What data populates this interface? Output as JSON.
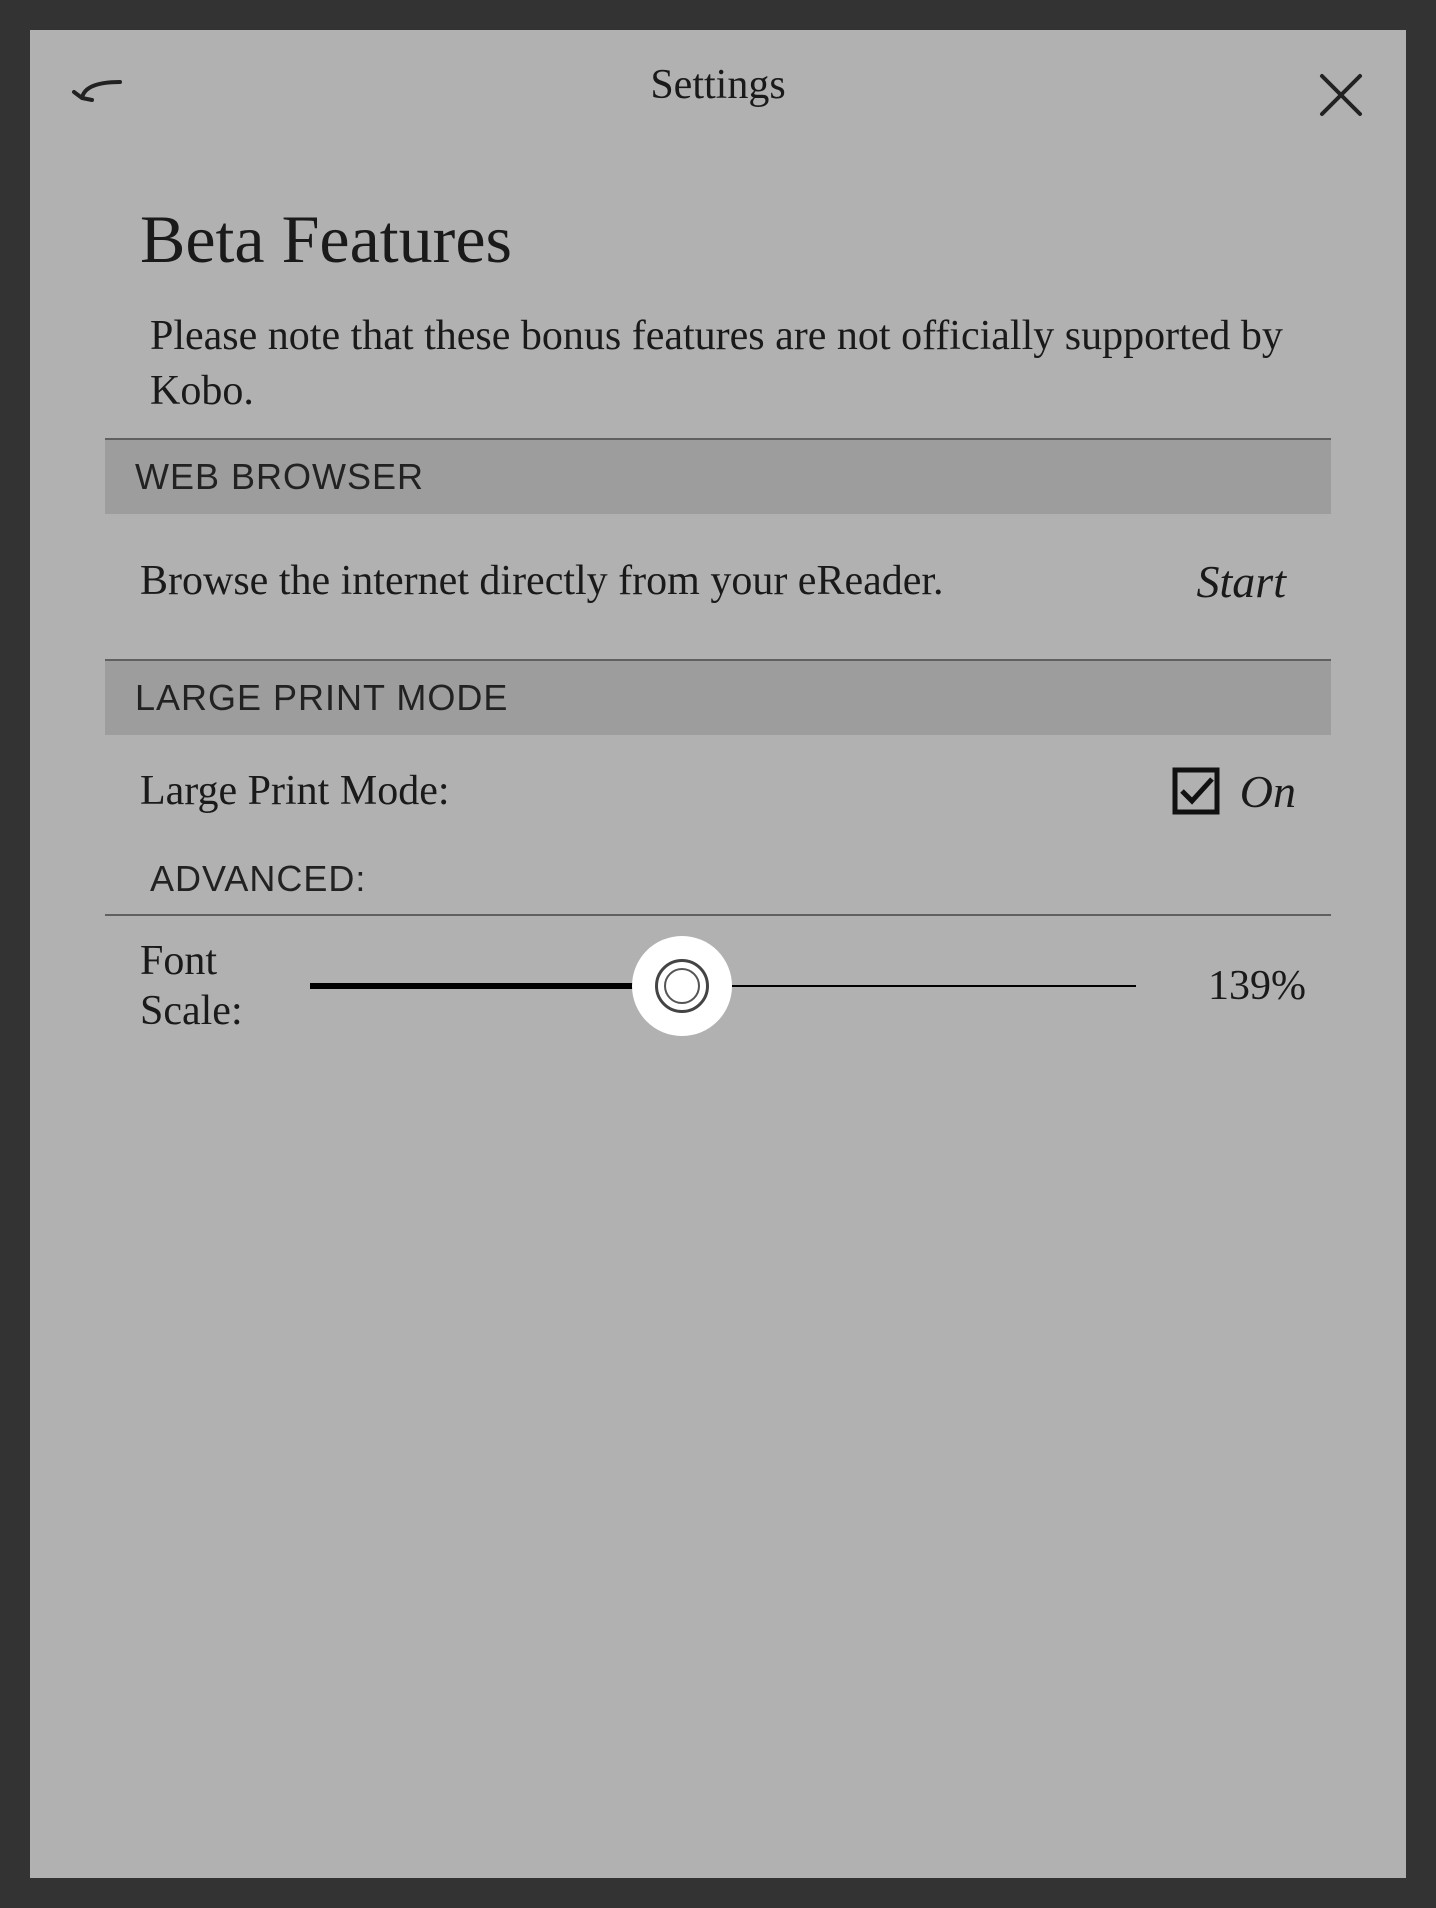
{
  "header": {
    "title": "Settings"
  },
  "page": {
    "heading": "Beta Features",
    "note": "Please note that these bonus features are not officially supported by Kobo."
  },
  "sections": {
    "web_browser": {
      "header": "WEB BROWSER",
      "description": "Browse the internet directly from your eReader.",
      "action_label": "Start"
    },
    "large_print": {
      "header": "LARGE PRINT MODE",
      "label": "Large Print Mode:",
      "checked": true,
      "state_label": "On",
      "advanced_label": "ADVANCED:",
      "font_scale": {
        "label": "Font Scale:",
        "value_text": "139%",
        "percent_position": 45
      }
    }
  }
}
